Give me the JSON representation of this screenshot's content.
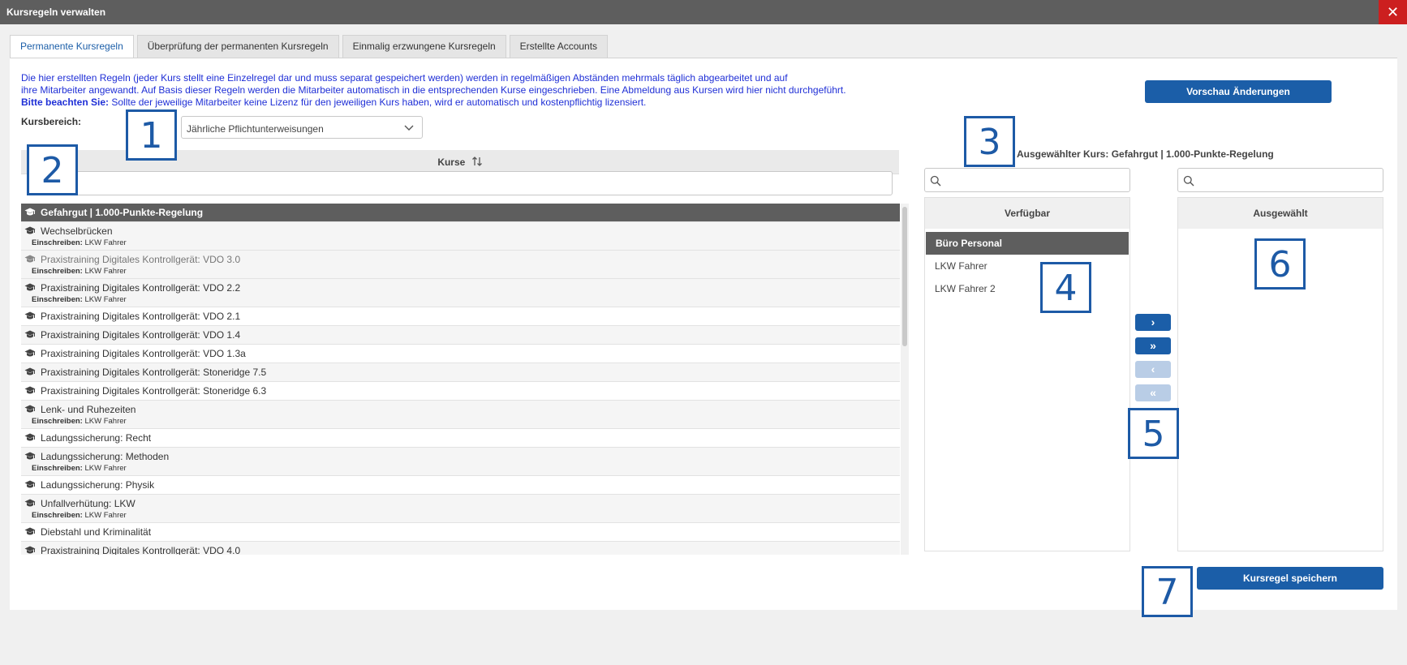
{
  "window": {
    "title": "Kursregeln verwalten",
    "close_label": "✕"
  },
  "tabs": [
    {
      "label": "Permanente Kursregeln",
      "active": true
    },
    {
      "label": "Überprüfung der permanenten Kursregeln",
      "active": false
    },
    {
      "label": "Einmalig erzwungene Kursregeln",
      "active": false
    },
    {
      "label": "Erstellte Accounts",
      "active": false
    }
  ],
  "info": {
    "line1": "Die hier erstellten Regeln (jeder Kurs stellt eine Einzelregel dar und muss separat gespeichert werden) werden in regelmäßigen Abständen mehrmals täglich abgearbeitet und auf",
    "line2": "ihre Mitarbeiter angewandt. Auf Basis dieser Regeln werden die Mitarbeiter automatisch in die entsprechenden Kurse eingeschrieben. Eine Abmeldung aus Kursen wird hier nicht durchgeführt.",
    "note_bold": "Bitte beachten Sie:",
    "note_text": " Sollte der jeweilige Mitarbeiter keine Lizenz für den jeweiligen Kurs haben, wird er automatisch und kostenpflichtig lizensiert."
  },
  "preview_button": "Vorschau Änderungen",
  "kursbereich": {
    "label": "Kursbereich:",
    "value": "Jährliche Pflichtunterweisungen"
  },
  "grid": {
    "header": "Kurse",
    "sort_icon": "sort-arrows-icon",
    "filter_value": "",
    "enroll_label": "Einschreiben:",
    "rows": [
      {
        "name": "Gefahrgut | 1.000-Punkte-Regelung",
        "enroll": "",
        "selected": true
      },
      {
        "name": "Wechselbrücken",
        "enroll": "LKW Fahrer"
      },
      {
        "name": "Praxistraining Digitales Kontrollgerät: VDO 3.0",
        "enroll": "LKW Fahrer",
        "muted": true
      },
      {
        "name": "Praxistraining Digitales Kontrollgerät: VDO 2.2",
        "enroll": "LKW Fahrer"
      },
      {
        "name": "Praxistraining Digitales Kontrollgerät: VDO 2.1",
        "enroll": "",
        "white": true
      },
      {
        "name": "Praxistraining Digitales Kontrollgerät: VDO 1.4",
        "enroll": ""
      },
      {
        "name": "Praxistraining Digitales Kontrollgerät: VDO 1.3a",
        "enroll": "",
        "white": true
      },
      {
        "name": "Praxistraining Digitales Kontrollgerät: Stoneridge 7.5",
        "enroll": ""
      },
      {
        "name": "Praxistraining Digitales Kontrollgerät: Stoneridge 6.3",
        "enroll": "",
        "white": true
      },
      {
        "name": "Lenk- und Ruhezeiten",
        "enroll": "LKW Fahrer"
      },
      {
        "name": "Ladungssicherung: Recht",
        "enroll": "",
        "white": true
      },
      {
        "name": "Ladungssicherung: Methoden",
        "enroll": "LKW Fahrer"
      },
      {
        "name": "Ladungssicherung: Physik",
        "enroll": "",
        "white": true
      },
      {
        "name": "Unfallverhütung: LKW",
        "enroll": "LKW Fahrer"
      },
      {
        "name": "Diebstahl und Kriminalität",
        "enroll": "",
        "white": true
      },
      {
        "name": "Praxistraining Digitales Kontrollgerät: VDO 4.0",
        "enroll": ""
      }
    ]
  },
  "selected_course": {
    "label": "Ausgewählter Kurs: Gefahrgut | 1.000-Punkte-Regelung"
  },
  "available": {
    "header": "Verfügbar",
    "search_value": "",
    "items": [
      {
        "label": "Büro Personal",
        "selected": true
      },
      {
        "label": "LKW Fahrer",
        "selected": false
      },
      {
        "label": "LKW Fahrer 2",
        "selected": false
      }
    ]
  },
  "chosen": {
    "header": "Ausgewählt",
    "search_value": "",
    "items": []
  },
  "move_buttons": [
    {
      "label": "›",
      "name": "move-right-button",
      "enabled": true
    },
    {
      "label": "»",
      "name": "move-all-right-button",
      "enabled": true
    },
    {
      "label": "‹",
      "name": "move-left-button",
      "enabled": false
    },
    {
      "label": "«",
      "name": "move-all-left-button",
      "enabled": false
    }
  ],
  "save_button": "Kursregel speichern",
  "annotations": [
    "1",
    "2",
    "3",
    "4",
    "5",
    "6",
    "7"
  ],
  "colors": {
    "accent": "#1b5ea8",
    "info_text": "#1f2fd6",
    "close": "#cc1f1f",
    "selected_row": "#5e5e5e",
    "annotation": "#1d5aa6"
  }
}
